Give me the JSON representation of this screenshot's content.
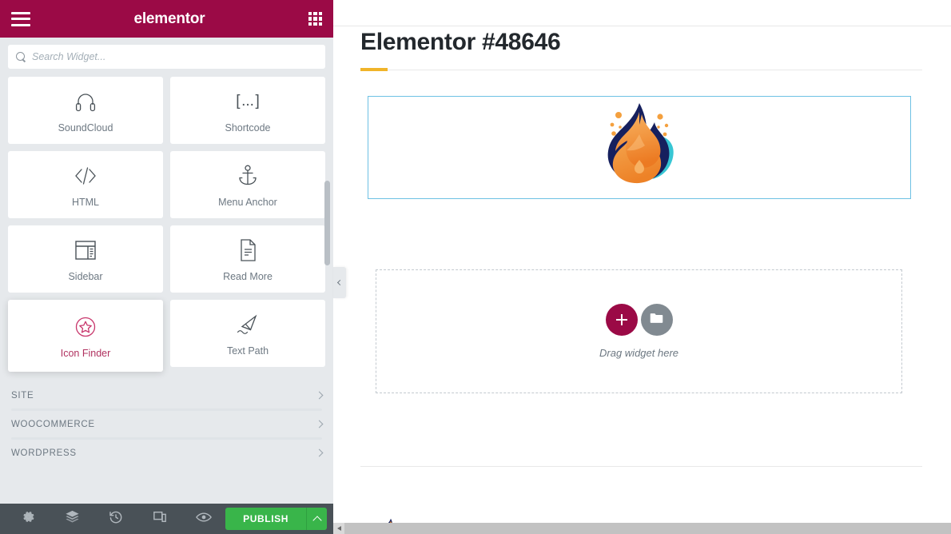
{
  "panel": {
    "header": {
      "menu_icon": "hamburger-icon",
      "logo_text": "elementor",
      "grid_icon": "widgets-grid-icon"
    },
    "search": {
      "placeholder": "Search Widget...",
      "value": "",
      "icon": "search-icon"
    },
    "widgets": [
      {
        "label": "SoundCloud",
        "icon": "headphones-icon",
        "state": "normal"
      },
      {
        "label": "Shortcode",
        "icon": "brackets-icon",
        "state": "normal"
      },
      {
        "label": "HTML",
        "icon": "code-icon",
        "state": "normal"
      },
      {
        "label": "Menu Anchor",
        "icon": "anchor-icon",
        "state": "normal"
      },
      {
        "label": "Sidebar",
        "icon": "sidebar-layout-icon",
        "state": "normal"
      },
      {
        "label": "Read More",
        "icon": "document-icon",
        "state": "normal"
      },
      {
        "label": "Icon Finder",
        "icon": "star-circle-icon",
        "state": "hovered"
      },
      {
        "label": "Text Path",
        "icon": "text-path-icon",
        "state": "normal"
      }
    ],
    "categories": [
      {
        "label": "SITE",
        "chevron": "chevron-right-icon"
      },
      {
        "label": "WOOCOMMERCE",
        "chevron": "chevron-right-icon"
      },
      {
        "label": "WORDPRESS",
        "chevron": "chevron-right-icon"
      }
    ],
    "footer": {
      "buttons": [
        {
          "name": "settings",
          "icon": "gear-icon"
        },
        {
          "name": "navigator",
          "icon": "layers-icon"
        },
        {
          "name": "history",
          "icon": "history-clock-icon"
        },
        {
          "name": "responsive-mode",
          "icon": "responsive-device-icon"
        },
        {
          "name": "preview-changes",
          "icon": "eye-icon"
        }
      ],
      "publish_label": "PUBLISH",
      "publish_caret": "caret-up-icon",
      "publish_color": "#39b54a"
    },
    "scrollbar": "vertical-scrollbar",
    "collapse_handle": "chevron-left-icon",
    "bg_color": "#e6e9ec",
    "header_color": "#9b0a46"
  },
  "canvas": {
    "page_title": "Elementor #48646",
    "title_accent_color": "#f0b429",
    "section_border_color": "#6ec1e4",
    "logo": {
      "name": "flame-logo",
      "outline_color": "#16205e",
      "fill_color_light": "#f5a74e",
      "fill_color_dark": "#ef7f2a",
      "accent_color": "#37c6d4"
    },
    "drop_zone": {
      "add_section_label": "+",
      "add_section_color": "#9b0a46",
      "add_template_icon": "folder-icon",
      "add_template_color": "#818a91",
      "hint": "Drag widget here"
    },
    "horizontal_scrollbar": "horizontal-scrollbar"
  }
}
